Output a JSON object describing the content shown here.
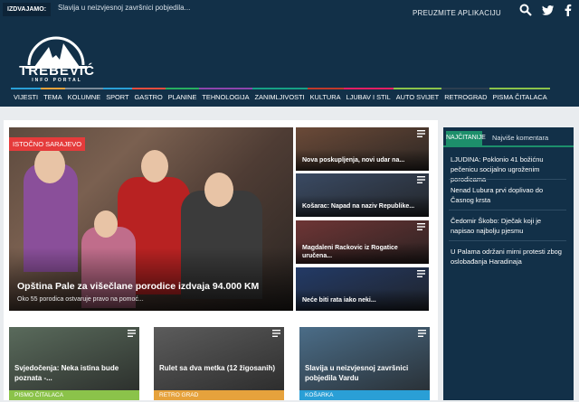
{
  "header": {
    "ticker_label": "IZDVAJAMO:",
    "ticker_text": "Slavija u neizvjesnoj završnici pobjedila...",
    "apps_link": "PREUZMITE APLIKACIJU",
    "logo_title": "TREBEVIĆ",
    "logo_subtitle": "INFO PORTAL",
    "icons": [
      "search-icon",
      "twitter-icon",
      "facebook-icon"
    ]
  },
  "nav": {
    "items": [
      {
        "label": "VIJESTI",
        "color": "#2a9fd6"
      },
      {
        "label": "TEMA",
        "color": "#e6a23c"
      },
      {
        "label": "KOLUMNE",
        "color": "#7a8b99"
      },
      {
        "label": "SPORT",
        "color": "#2a9fd6"
      },
      {
        "label": "GASTRO",
        "color": "#e84c3d"
      },
      {
        "label": "PLANINE",
        "color": "#27ae60"
      },
      {
        "label": "TEHNOLOGIJA",
        "color": "#8e44ad"
      },
      {
        "label": "ZANIMLJIVOSTI",
        "color": "#16a085"
      },
      {
        "label": "KULTURA",
        "color": "#c0392b"
      },
      {
        "label": "LJUBAV I STIL",
        "color": "#e91e63"
      },
      {
        "label": "AUTO SVIJET",
        "color": "#8bc34a"
      },
      {
        "label": "RETROGRAD",
        "color": "#2c3e50"
      },
      {
        "label": "PISMA ČITALACA",
        "color": "#8bc34a"
      }
    ]
  },
  "hero": {
    "category": "ISTOČNO SARAJEVO",
    "title": "Opština Pale za višečlane porodice izdvaja 94.000 KM",
    "excerpt": "Oko 55 porodica ostvaruje pravo na pomoć..."
  },
  "side_cards": [
    {
      "title": "Nova poskupljenja, novi udar na...",
      "bg": "#6b4a38"
    },
    {
      "title": "Košarac: Napad na naziv Republike...",
      "bg": "#3a4a63"
    },
    {
      "title": "Magdaleni Rackovic iz Rogatice uručena...",
      "bg": "#6e3535"
    },
    {
      "title": "Neće biti rata iako neki...",
      "bg": "#233a66"
    }
  ],
  "bottom_cards": [
    {
      "title": "Svjedočenja: Neka istina bude poznata -...",
      "category": "PISMO ČITALACA",
      "cat_color": "#8bc34a",
      "bg": "#5a6b5c"
    },
    {
      "title": "Rulet sa dva metka (12 žigosanih)",
      "category": "RETRO GRAD",
      "cat_color": "#e6a23c",
      "bg": "#5c5c5c"
    },
    {
      "title": "Slavija u neizvjesnoj završnici pobjedila Vardu",
      "category": "KOŠARKA",
      "cat_color": "#2a9fd6",
      "bg": "#4b6d88"
    }
  ],
  "sidebar": {
    "tab_active": "NAJČITANIJE",
    "tab_other": "Najviše komentara",
    "items": [
      "LJUDINA: Poklonio 41 božićnu pečenicu socijalno ugroženim porodicama",
      "Nenad Lubura prvi doplivao do Časnog krsta",
      "Čedomir Škobo: Dječak koji je napisao najbolju pjesmu",
      "U Palama održani mirni protesti zbog oslobađanja Haradinaja"
    ]
  }
}
